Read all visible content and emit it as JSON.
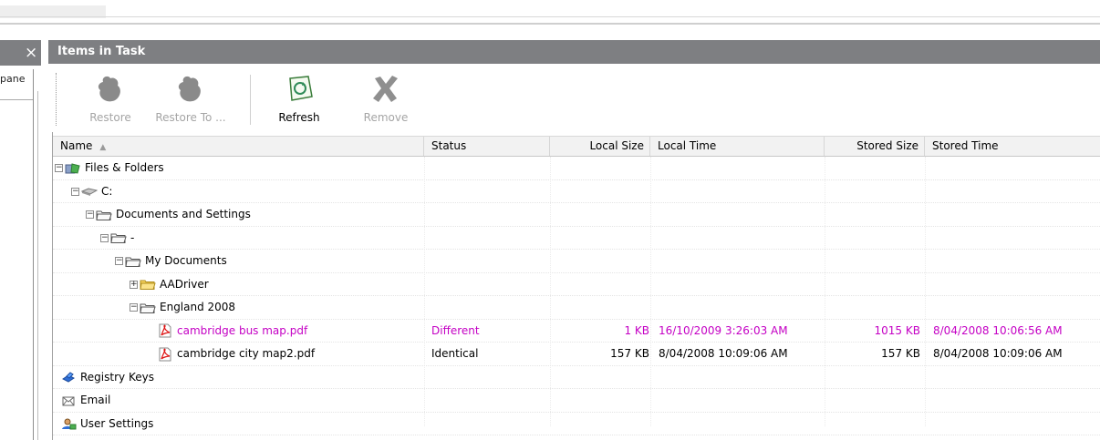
{
  "left_pane": {
    "close_label": "×",
    "partial_label": "pane"
  },
  "panel": {
    "title": "Items in Task"
  },
  "toolbar": {
    "restore_label": "Restore",
    "restore_to_label": "Restore To ...",
    "refresh_label": "Refresh",
    "remove_label": "Remove"
  },
  "columns": {
    "name": "Name",
    "status": "Status",
    "local_size": "Local Size",
    "local_time": "Local Time",
    "stored_size": "Stored Size",
    "stored_time": "Stored Time"
  },
  "rows": [
    {
      "name": "Files & Folders",
      "status": "",
      "local_size": "",
      "local_time": "",
      "stored_size": "",
      "stored_time": "",
      "icon": "files-folders-icon",
      "toggle": "−"
    },
    {
      "name": "C:",
      "status": "",
      "local_size": "",
      "local_time": "",
      "stored_size": "",
      "stored_time": "",
      "icon": "drive-icon",
      "toggle": "−"
    },
    {
      "name": "Documents and Settings",
      "status": "",
      "local_size": "",
      "local_time": "",
      "stored_size": "",
      "stored_time": "",
      "icon": "folder-icon",
      "toggle": "−"
    },
    {
      "name": "-",
      "status": "",
      "local_size": "",
      "local_time": "",
      "stored_size": "",
      "stored_time": "",
      "icon": "folder-icon",
      "toggle": "−"
    },
    {
      "name": "My Documents",
      "status": "",
      "local_size": "",
      "local_time": "",
      "stored_size": "",
      "stored_time": "",
      "icon": "folder-icon",
      "toggle": "−"
    },
    {
      "name": "AADriver",
      "status": "",
      "local_size": "",
      "local_time": "",
      "stored_size": "",
      "stored_time": "",
      "icon": "folder-icon",
      "toggle": "+"
    },
    {
      "name": "England 2008",
      "status": "",
      "local_size": "",
      "local_time": "",
      "stored_size": "",
      "stored_time": "",
      "icon": "folder-icon",
      "toggle": "−"
    },
    {
      "name": "cambridge bus map.pdf",
      "status": "Different",
      "local_size": "1 KB",
      "local_time": "16/10/2009 3:26:03 AM",
      "stored_size": "1015 KB",
      "stored_time": "8/04/2008 10:06:56 AM",
      "icon": "pdf-icon",
      "toggle": ""
    },
    {
      "name": "cambridge city map2.pdf",
      "status": "Identical",
      "local_size": "157 KB",
      "local_time": "8/04/2008 10:09:06 AM",
      "stored_size": "157 KB",
      "stored_time": "8/04/2008 10:09:06 AM",
      "icon": "pdf-icon",
      "toggle": ""
    },
    {
      "name": "Registry Keys",
      "status": "",
      "local_size": "",
      "local_time": "",
      "stored_size": "",
      "stored_time": "",
      "icon": "registry-icon",
      "toggle": ""
    },
    {
      "name": "Email",
      "status": "",
      "local_size": "",
      "local_time": "",
      "stored_size": "",
      "stored_time": "",
      "icon": "email-icon",
      "toggle": ""
    },
    {
      "name": "User Settings",
      "status": "",
      "local_size": "",
      "local_time": "",
      "stored_size": "",
      "stored_time": "",
      "icon": "user-settings-icon",
      "toggle": ""
    }
  ],
  "colors": {
    "header_bar": "#7e7f82",
    "different_status": "#c400c4"
  }
}
